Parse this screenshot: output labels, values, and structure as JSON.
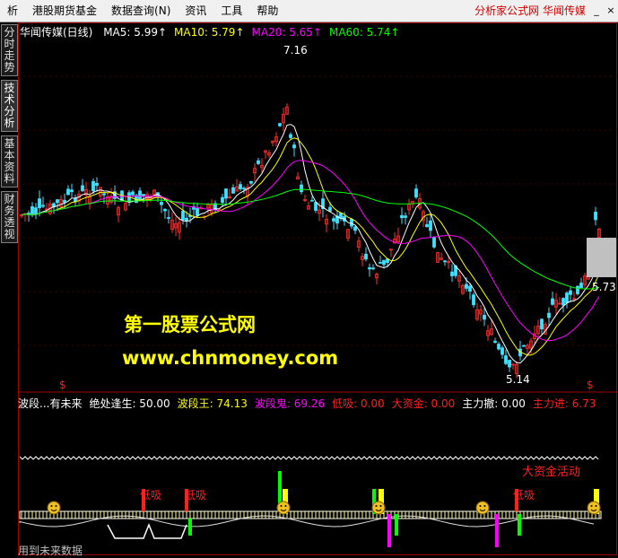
{
  "menu": {
    "items": [
      "析",
      "港股期货基金",
      "数据查询(N)",
      "资讯",
      "工具",
      "帮助"
    ],
    "brand": "分析家公式网 华闻传媒",
    "min": "_",
    "close": "×"
  },
  "side_tabs": [
    "分时走势",
    "技术分析",
    "基本资料",
    "财务透视"
  ],
  "price_panel": {
    "title": "华闻传媒(日线)",
    "ma": [
      {
        "label": "MA5: 5.99",
        "color": "#ffffff"
      },
      {
        "label": "MA10: 5.79",
        "color": "#ffff00"
      },
      {
        "label": "MA20: 5.65",
        "color": "#ff00ff"
      },
      {
        "label": "MA60: 5.74",
        "color": "#00ff00"
      }
    ],
    "high_label": "7.16",
    "low_label": "5.14",
    "right_label": "5.73",
    "dollar": "$"
  },
  "indicator_panel": {
    "values": [
      {
        "label": "波段...有未来",
        "color": "#ffffff"
      },
      {
        "label": "绝处逢生: 50.00",
        "color": "#ffffff"
      },
      {
        "label": "波段王: 74.13",
        "color": "#ffff00"
      },
      {
        "label": "波段鬼: 69.26",
        "color": "#ff00ff"
      },
      {
        "label": "低吸: 0.00",
        "color": "#ff2020"
      },
      {
        "label": "大资金: 0.00",
        "color": "#ff2020"
      },
      {
        "label": "主力撤: 0.00",
        "color": "#ffffff"
      },
      {
        "label": "主力进: 6.73",
        "color": "#ff2020"
      }
    ],
    "dixi_labels": [
      "低吸",
      "低吸",
      "低吸"
    ],
    "dazijin_label": "大资金活动",
    "footer": "用到未来数据"
  },
  "watermark": {
    "title": "第一股票公式网",
    "url": "www.chnmoney.com"
  }
}
